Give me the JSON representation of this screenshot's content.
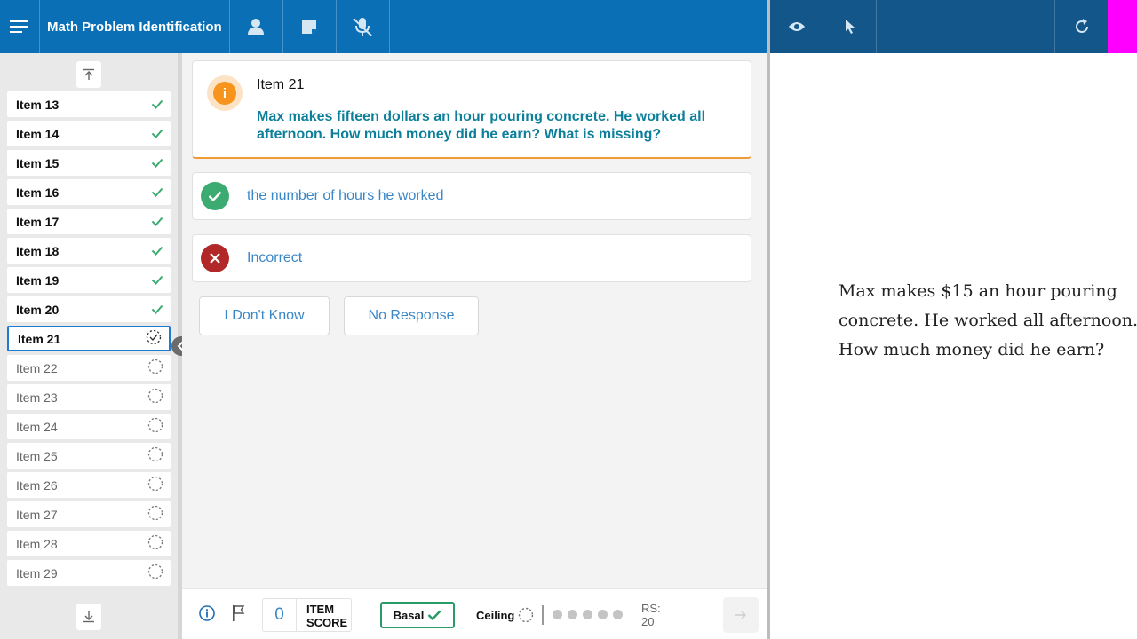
{
  "header": {
    "title": "Math Problem Identification",
    "menu_icon": "hamburger-icon",
    "buttons": [
      "person-icon",
      "note-icon",
      "mic-off-icon"
    ],
    "colors": {
      "bar": "#0a6fb5",
      "right_bar": "#12568a",
      "marker": "#ff00ff"
    }
  },
  "right_header": {
    "buttons": [
      "eye-icon",
      "pointer-icon",
      "refresh-icon"
    ]
  },
  "sidebar": {
    "items": [
      {
        "label": "Item 13",
        "status": "done"
      },
      {
        "label": "Item 14",
        "status": "done"
      },
      {
        "label": "Item 15",
        "status": "done"
      },
      {
        "label": "Item 16",
        "status": "done"
      },
      {
        "label": "Item 17",
        "status": "done"
      },
      {
        "label": "Item 18",
        "status": "done"
      },
      {
        "label": "Item 19",
        "status": "done"
      },
      {
        "label": "Item 20",
        "status": "done"
      },
      {
        "label": "Item 21",
        "status": "current"
      },
      {
        "label": "Item 22",
        "status": "pending"
      },
      {
        "label": "Item 23",
        "status": "pending"
      },
      {
        "label": "Item 24",
        "status": "pending"
      },
      {
        "label": "Item 25",
        "status": "pending"
      },
      {
        "label": "Item 26",
        "status": "pending"
      },
      {
        "label": "Item 27",
        "status": "pending"
      },
      {
        "label": "Item 28",
        "status": "pending"
      },
      {
        "label": "Item 29",
        "status": "pending"
      }
    ]
  },
  "question": {
    "title": "Item 21",
    "text": "Max makes fifteen dollars an hour pouring concrete. He worked all afternoon. How much money did he earn? What is missing?",
    "accent_color": "#f29a36"
  },
  "answers": {
    "correct": "the number of hours he worked",
    "incorrect": "Incorrect"
  },
  "options": {
    "dont_know": "I Don't Know",
    "no_response": "No Response"
  },
  "footer": {
    "score_value": "0",
    "score_label_1": "ITEM",
    "score_label_2": "SCORE",
    "basal_label": "Basal",
    "ceiling_label": "Ceiling",
    "rs_label": "RS:",
    "rs_value": "20"
  },
  "stimulus": {
    "lines": [
      "Max makes $15 an hour pouring",
      "concrete. He worked all afternoon.",
      "How much money did he earn?"
    ]
  }
}
